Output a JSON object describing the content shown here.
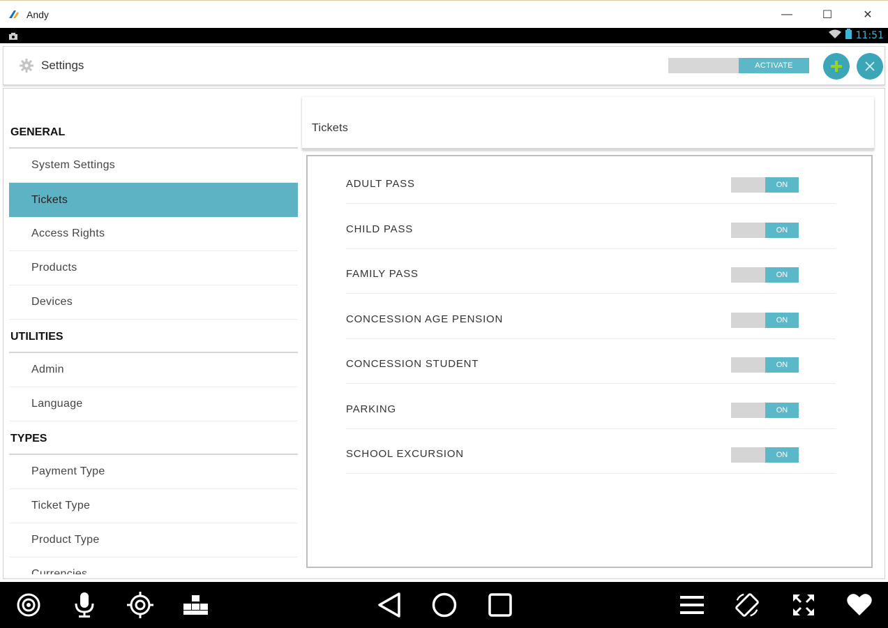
{
  "window": {
    "title": "Andy",
    "minimize_glyph": "—",
    "maximize_glyph": "☐",
    "close_glyph": "✕"
  },
  "status_bar": {
    "time": "11:51",
    "icons": [
      "camera-icon",
      "wifi-icon",
      "battery-icon"
    ]
  },
  "header": {
    "title": "Settings",
    "activate_label": "ACTIVATE",
    "add_button_icon": "plus-icon",
    "close_button_icon": "close-icon"
  },
  "sidebar": {
    "sections": [
      {
        "title": "GENERAL",
        "items": [
          "System Settings",
          "Tickets",
          "Access Rights",
          "Products",
          "Devices"
        ]
      },
      {
        "title": "UTILITIES",
        "items": [
          "Admin",
          "Language"
        ]
      },
      {
        "title": "TYPES",
        "items": [
          "Payment Type",
          "Ticket Type",
          "Product Type",
          "Currencies"
        ]
      }
    ],
    "active_item": "Tickets"
  },
  "panel": {
    "title": "Tickets",
    "tickets": [
      {
        "label": "ADULT PASS",
        "toggle": "ON"
      },
      {
        "label": "CHILD PASS",
        "toggle": "ON"
      },
      {
        "label": "FAMILY PASS",
        "toggle": "ON"
      },
      {
        "label": "CONCESSION AGE PENSION",
        "toggle": "ON"
      },
      {
        "label": "CONCESSION STUDENT",
        "toggle": "ON"
      },
      {
        "label": "PARKING",
        "toggle": "ON"
      },
      {
        "label": "SCHOOL EXCURSION",
        "toggle": "ON"
      }
    ]
  },
  "bottom_bar": {
    "icons": [
      "camera-lens-icon",
      "microphone-icon",
      "location-target-icon",
      "apps-grid-icon",
      "back-icon",
      "home-icon",
      "recents-icon",
      "menu-icon",
      "rotate-icon",
      "fullscreen-icon",
      "heart-icon"
    ]
  },
  "colors": {
    "accent": "#5bb8c8",
    "round_button": "#3aa6b7",
    "toggle_off": "#d5d5d5",
    "status_time": "#3bb6d8"
  }
}
